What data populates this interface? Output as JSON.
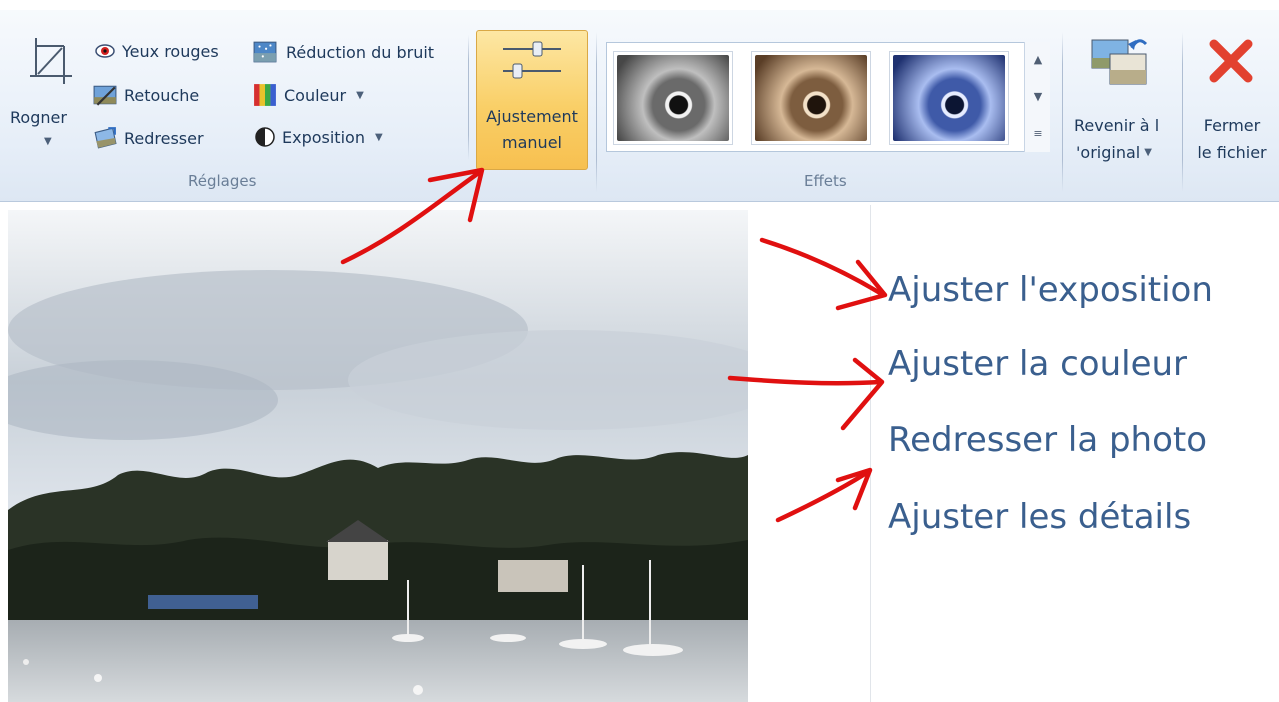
{
  "ribbon": {
    "reglages": {
      "group_label": "Réglages",
      "rogner_label": "Rogner",
      "yeux_rouges_label": "Yeux rouges",
      "retouche_label": "Retouche",
      "redresser_label": "Redresser",
      "reduction_bruit_label": "Réduction du bruit",
      "couleur_label": "Couleur",
      "exposition_label": "Exposition",
      "ajustement_line1": "Ajustement",
      "ajustement_line2": "manuel"
    },
    "effets": {
      "group_label": "Effets",
      "thumbnails": [
        "grayscale",
        "sepia",
        "cyan"
      ]
    },
    "revenir_line1": "Revenir à l",
    "revenir_line2": "'original",
    "fermer_line1": "Fermer",
    "fermer_line2": "le fichier"
  },
  "side_panel": {
    "items": [
      "Ajuster l'exposition",
      "Ajuster la couleur",
      "Redresser la photo",
      "Ajuster les détails"
    ]
  },
  "colors": {
    "annotation": "#e01010",
    "accent_button": "#f9cf67",
    "action_text": "#3a5f8e"
  }
}
